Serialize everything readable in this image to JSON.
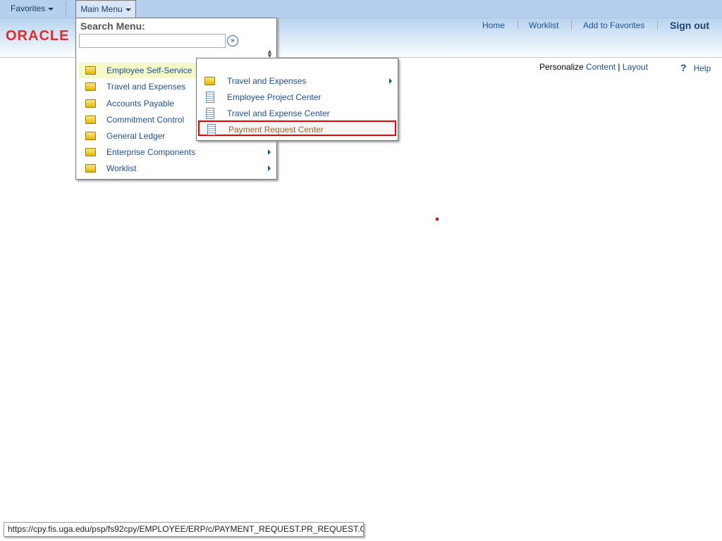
{
  "nav": {
    "favorites": "Favorites",
    "main_menu": "Main Menu"
  },
  "logo": "ORACLE",
  "header_links": {
    "home": "Home",
    "worklist": "Worklist",
    "add_favorites": "Add to Favorites",
    "sign_out": "Sign out"
  },
  "personalize": {
    "label": "Personalize",
    "content": "Content",
    "sep": "|",
    "layout": "Layout"
  },
  "help": {
    "icon": "?",
    "label": "Help"
  },
  "menu": {
    "search_label": "Search Menu:",
    "search_value": "",
    "go_icon": "»",
    "items": [
      {
        "label": "Employee Self-Service",
        "icon": "folder",
        "submenu": true,
        "highlighted": true
      },
      {
        "label": "Travel and Expenses",
        "icon": "folder"
      },
      {
        "label": "Accounts Payable",
        "icon": "folder"
      },
      {
        "label": "Commitment Control",
        "icon": "folder"
      },
      {
        "label": "General Ledger",
        "icon": "folder"
      },
      {
        "label": "Enterprise Components",
        "icon": "folder",
        "submenu": true
      },
      {
        "label": "Worklist",
        "icon": "folder",
        "submenu": true
      }
    ]
  },
  "submenu": {
    "items": [
      {
        "label": "Travel and Expenses",
        "icon": "folder",
        "submenu": true
      },
      {
        "label": "Employee Project Center",
        "icon": "document"
      },
      {
        "label": "Travel and Expense Center",
        "icon": "document"
      },
      {
        "label": "Payment Request Center",
        "icon": "document",
        "selected": true
      }
    ]
  },
  "status_url": "https://cpy.fis.uga.edu/psp/fs92cpy/EMPLOYEE/ERP/c/PAYMENT_REQUEST.PR_REQUEST.GB...",
  "colors": {
    "accent": "#1f4f8e",
    "selection_border": "#ee0000",
    "logo": "#e3292a"
  }
}
